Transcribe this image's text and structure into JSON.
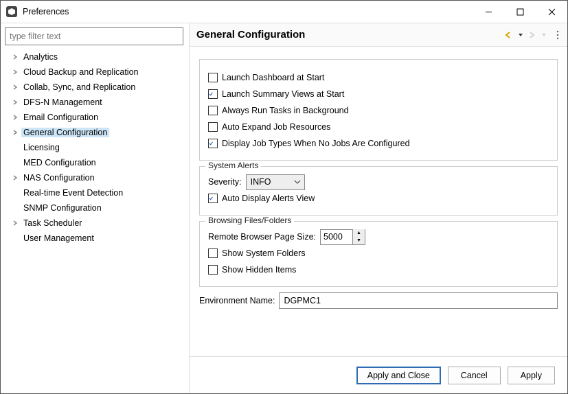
{
  "window": {
    "title": "Preferences"
  },
  "filter": {
    "placeholder": "type filter text"
  },
  "tree": [
    {
      "label": "Analytics",
      "expandable": true
    },
    {
      "label": "Cloud Backup and Replication",
      "expandable": true
    },
    {
      "label": "Collab, Sync, and Replication",
      "expandable": true
    },
    {
      "label": "DFS-N Management",
      "expandable": true
    },
    {
      "label": "Email Configuration",
      "expandable": true
    },
    {
      "label": "General Configuration",
      "expandable": true,
      "selected": true
    },
    {
      "label": "Licensing",
      "expandable": false
    },
    {
      "label": "MED Configuration",
      "expandable": false
    },
    {
      "label": "NAS Configuration",
      "expandable": true
    },
    {
      "label": "Real-time Event Detection",
      "expandable": false
    },
    {
      "label": "SNMP Configuration",
      "expandable": false
    },
    {
      "label": "Task Scheduler",
      "expandable": true
    },
    {
      "label": "User Management",
      "expandable": false
    }
  ],
  "header": {
    "title": "General Configuration"
  },
  "startup": {
    "launch_dashboard": {
      "label": "Launch Dashboard at Start",
      "checked": false
    },
    "launch_summary": {
      "label": "Launch Summary Views at Start",
      "checked": true
    },
    "always_bg": {
      "label": "Always Run Tasks in Background",
      "checked": false
    },
    "auto_expand": {
      "label": "Auto Expand Job Resources",
      "checked": false
    },
    "display_job_types": {
      "label": "Display Job Types When No Jobs Are Configured",
      "checked": true
    }
  },
  "alerts": {
    "legend": "System Alerts",
    "severity_label": "Severity:",
    "severity_value": "INFO",
    "auto_display": {
      "label": "Auto Display Alerts View",
      "checked": true
    }
  },
  "browsing": {
    "legend": "Browsing Files/Folders",
    "page_size_label": "Remote Browser Page Size:",
    "page_size_value": "5000",
    "show_system": {
      "label": "Show System Folders",
      "checked": false
    },
    "show_hidden": {
      "label": "Show Hidden Items",
      "checked": false
    }
  },
  "env": {
    "label": "Environment Name:",
    "value": "DGPMC1"
  },
  "footer": {
    "apply_close": "Apply and Close",
    "cancel": "Cancel",
    "apply": "Apply"
  }
}
